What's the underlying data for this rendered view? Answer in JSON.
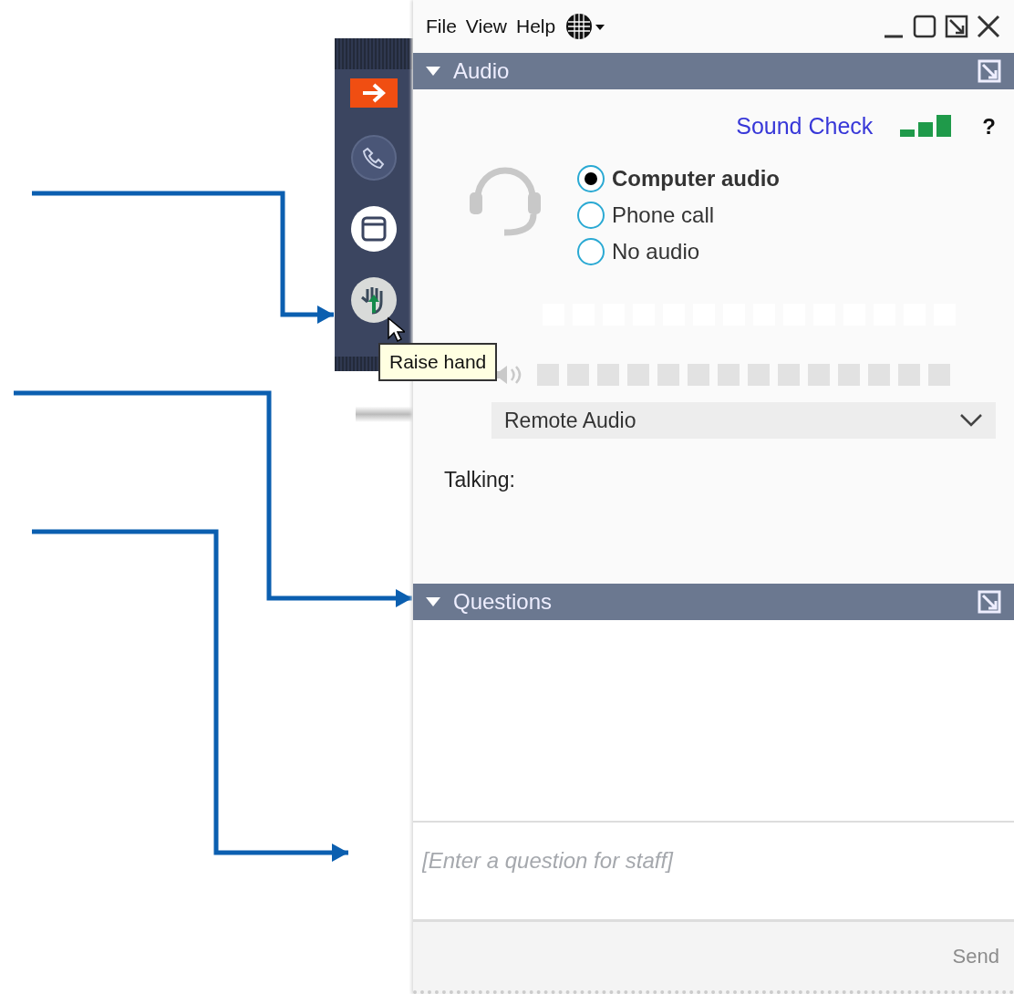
{
  "menu": [
    {
      "label": "File"
    },
    {
      "label": "View"
    },
    {
      "label": "Help"
    }
  ],
  "tooltip": "Raise hand",
  "audio": {
    "title": "Audio",
    "expanded": true,
    "sound_check": "Sound Check",
    "help": "?",
    "options": [
      {
        "label": "Computer audio",
        "selected": true
      },
      {
        "label": "Phone call",
        "selected": false
      },
      {
        "label": "No audio",
        "selected": false
      }
    ],
    "device": "Remote Audio",
    "talking": "Talking:"
  },
  "questions": {
    "title": "Questions",
    "expanded": true,
    "placeholder": "[Enter a question for staff]",
    "send": "Send",
    "send_disabled": true
  }
}
